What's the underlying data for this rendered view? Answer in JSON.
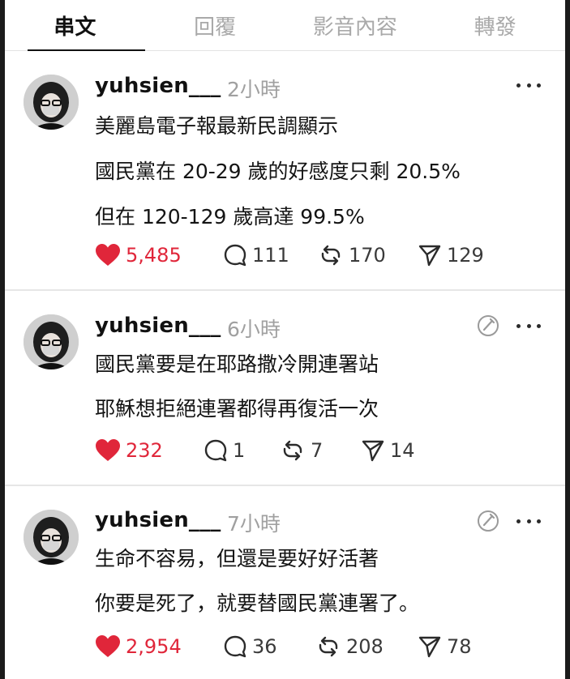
{
  "tabs": [
    {
      "label": "串文",
      "active": true
    },
    {
      "label": "回覆",
      "active": false
    },
    {
      "label": "影音內容",
      "active": false
    },
    {
      "label": "轉發",
      "active": false
    }
  ],
  "colors": {
    "like": "#e0263a",
    "muted": "#a0a0a0",
    "text": "#141414"
  },
  "posts": [
    {
      "username": "yuhsien___",
      "time": "2小時",
      "show_edit_icon": false,
      "lines": [
        "美麗島電子報最新民調顯示",
        "國民黨在 20-29 歲的好感度只剩 20.5%",
        "但在 120-129 歲高達 99.5%"
      ],
      "likes": "5,485",
      "comments": "111",
      "reposts": "170",
      "shares": "129"
    },
    {
      "username": "yuhsien___",
      "time": "6小時",
      "show_edit_icon": true,
      "lines": [
        "國民黨要是在耶路撒冷開連署站",
        "耶穌想拒絕連署都得再復活一次"
      ],
      "likes": "232",
      "comments": "1",
      "reposts": "7",
      "shares": "14"
    },
    {
      "username": "yuhsien___",
      "time": "7小時",
      "show_edit_icon": true,
      "lines": [
        "生命不容易，但還是要好好活著",
        "你要是死了，就要替國民黨連署了。"
      ],
      "likes": "2,954",
      "comments": "36",
      "reposts": "208",
      "shares": "78"
    }
  ]
}
